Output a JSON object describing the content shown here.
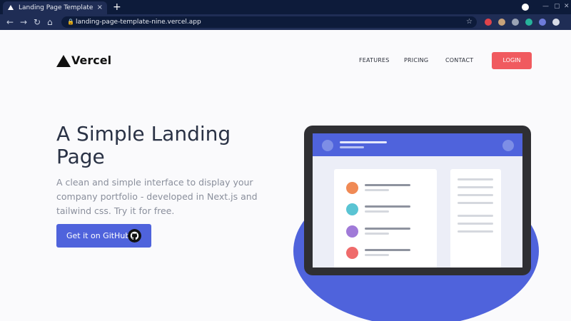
{
  "browser": {
    "tab_title": "Landing Page Template",
    "tab_close": "×",
    "new_tab": "+",
    "url": "landing-page-template-nine.vercel.app",
    "nav": {
      "back": "←",
      "forward": "→",
      "reload": "↻",
      "home": "⌂"
    },
    "star": "☆",
    "lock": "🔒",
    "window_controls": {
      "minimize": "—",
      "maximize": "▢",
      "close": "✕"
    },
    "extension_colors": [
      "#e0434a",
      "#c7a27a",
      "#9aa3b5",
      "#27b39b",
      "#6e7bd9",
      "#d7dbe6"
    ]
  },
  "header": {
    "logo_text": "Vercel",
    "nav": [
      {
        "label": "FEATURES"
      },
      {
        "label": "PRICING"
      },
      {
        "label": "CONTACT"
      }
    ],
    "login_label": "LOGIN"
  },
  "hero": {
    "title": "A Simple Landing Page",
    "subtitle": "A clean and simple interface to display your company portfolio - developed in Next.js and tailwind css. Try it for free.",
    "cta_label": "Get it on GitHub"
  },
  "illustration": {
    "row_colors": [
      "#f08a55",
      "#5ac4d3",
      "#a07ad8",
      "#ef6b6b"
    ]
  },
  "colors": {
    "accent": "#4f63dc",
    "login": "#f05a5f",
    "chrome": "#0d1b3a"
  }
}
